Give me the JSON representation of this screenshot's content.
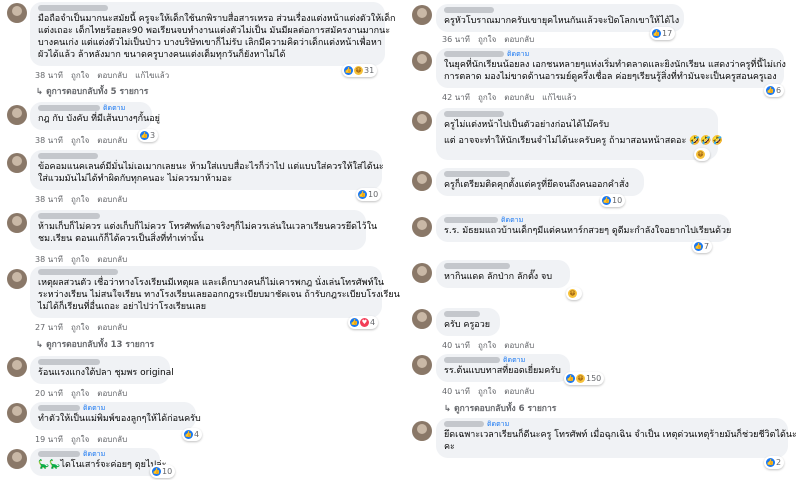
{
  "actions": {
    "like": "ถูกใจ",
    "reply": "ตอบกลับ",
    "edited": "แก้ไขแล้ว"
  },
  "follow_label": "ติดตาม",
  "left": [
    {
      "time": "38 นาที",
      "edited": true,
      "reactions": "31",
      "lines": [
        "มือถือจำเป็นมากนะสมัยนี้ ครูจะให้เด็กใช้นกพิราบสื่อสารเหรอ ส่วนเรื่องแต่งหน้าแต่งตัวให้เด็ก",
        "แต่งเถอะ เด็กไทยร้อยละ90 พอเรียนจบทำงานแต่งตัวไม่เป็น มันมีผลต่อการสมัครงานมากนะ",
        "บางคนเก่ง แต่แต่งตัวไม่เป็นป่าว บางบริษัทเขาก็ไม่รับ เลิกมีความคิดว่าเด็กแต่งหน้าเพื่อหา",
        "ผัวได้แล้ว ล้าหลังมาก ขนาดครูบางคนแต่งเต็มทุกวันก็ยังหาไม่ได้"
      ],
      "replies": "ดูการตอบกลับทั้ง 5 รายการ"
    },
    {
      "time": "38 นาที",
      "reactions": "3",
      "lines": [
        "กฎ กับ บังคับ ที่มีเส้นบางๆกั้นอยู่"
      ]
    },
    {
      "time": "38 นาที",
      "reactions": "10",
      "lines": [
        "ข้อคอมแนคเลนต์มีมั่นไม่เอเมากเลยนะ ห้ามใส่แบบสื่อะไรก็ว่าไป แต่แบบใส่ควรให้ใส่ได้นะ",
        "ใส่แวมมันไม่ได้ทำผิดกับทุกคนอะ ไม่ควรมาห้ามอะ"
      ]
    },
    {
      "time": "38 นาที",
      "lines": [
        "ห้ามเก็บก็ไม่ควร แต่งเก็บก็ไม่ควร โทรศัพท์เอาจริงๆก็ไม่ควรเล่นในเวลาเรียนควรยึดไว้ใน",
        "ชม.เรียน ตอนแก้ก็ได้ควรเป็นสิ่งที่ทำเท่านั้น"
      ]
    },
    {
      "time": "27 นาที",
      "reactions": "4",
      "lines": [
        "เหตุผลสวนตัว เชื่อว่าทางโรงเรียนมีเหตุผล และเด็กบางคนก็ไม่เคารพกฎ นั่งเล่นโทรศัพท์ใน",
        "ระหว่างเรียน ไม่สนใจเรียน ทางโรงเรียนเลยออกกฎระเบียบมาชัดเจน ถ้ารับกฎระเบียบโรงเรียน",
        "ไม่ได้ก็เรียนที่อื่นเถอะ อย่าไปว่าโรงเรียนเลย"
      ],
      "replies": "ดูการตอบกลับทั้ง 13 รายการ"
    },
    {
      "time": "20 นาที",
      "lines": [
        "ร้อนแรงแกงใต้ปลา ชุมพร original"
      ]
    },
    {
      "time": "19 นาที",
      "reactions": "4",
      "lines": [
        "ทำตัวให้เป็นแม่พิมพ์ของลูกๆให้ได้ก่อนครับ"
      ]
    },
    {
      "time": "",
      "reactions": "10",
      "lines": [
        "🦕🦕ไดโนเสาร์จะค่อยๆ ตุยไปล่ะ"
      ]
    }
  ],
  "right": [
    {
      "time": "36 นาที",
      "reactions": "17",
      "lines": [
        "ครูหัวโบราณมากครับเขายุคไหนกันแล้วจะปิดโลกเขาให้ได้ไง"
      ]
    },
    {
      "time": "42 นาที",
      "edited": true,
      "reactions": "6",
      "lines": [
        "ในยุคที่นักเรียนน้อยลง เอกชนหลายๆแห่งเริ่มทำตลาดและยิงนักเรียน แสดงว่าครูที่นี้ไม่เก่ง",
        "การตลาด มองไม่ขาดด้านอารมย์ดูครึ่งเชื่อล ค่อยๆเรียนรู้สิ่งที่ทำมันจะเป็นครูสอนครูเอง"
      ]
    },
    {
      "time": "42 นาที",
      "reactions": "",
      "lines": [
        "ครูไม่แต่งหน้าไปเป็นตัวอย่างก่อนได้ไม๊ครับ",
        "แต่ อาจจะทำให้นักเรียนจำไม่ได้นะครับครู ถ้ามาสอนหน้าสดอะ 🤣🤣🤣"
      ]
    },
    {
      "time": "",
      "reactions": "10",
      "lines": [
        "ครูก็เตรียมติดคุกตั้งแต่ครูที่ยึดจนถึงคนออกคำสั่ง"
      ]
    },
    {
      "time": "",
      "reactions": "7",
      "lines": [
        "ร.ร. มัธยมแถวบ้านเด็กๆมีแต่คนหาร์กสวยๆ ดูดีมะกำลังใจอยากไปเรียนด้วย"
      ]
    },
    {
      "time": "",
      "reactions": "",
      "lines": [
        "หากินแดด ลักป่าก ลักตั๊ง จบ"
      ]
    },
    {
      "time": "40 นาที",
      "lines": [
        "ครับ ครูอวย"
      ]
    },
    {
      "time": "40 นาที",
      "reactions": "150",
      "lines": [
        "รร.ต้นแบบทาสที่ยอดเยี่ยมครับ"
      ],
      "replies": "ดูการตอบกลับทั้ง 6 รายการ"
    },
    {
      "time": "",
      "reactions": "2",
      "lines": [
        "ยึดเฉพาะเวลาเรียนก็ดีนะครู โทรศัพท์ เมื่อฉุกเฉิน จำเป็น เหตุด่วนเหตุร้ายมันก็ช่วยชีวิตได้นะ",
        "คะ"
      ]
    }
  ]
}
